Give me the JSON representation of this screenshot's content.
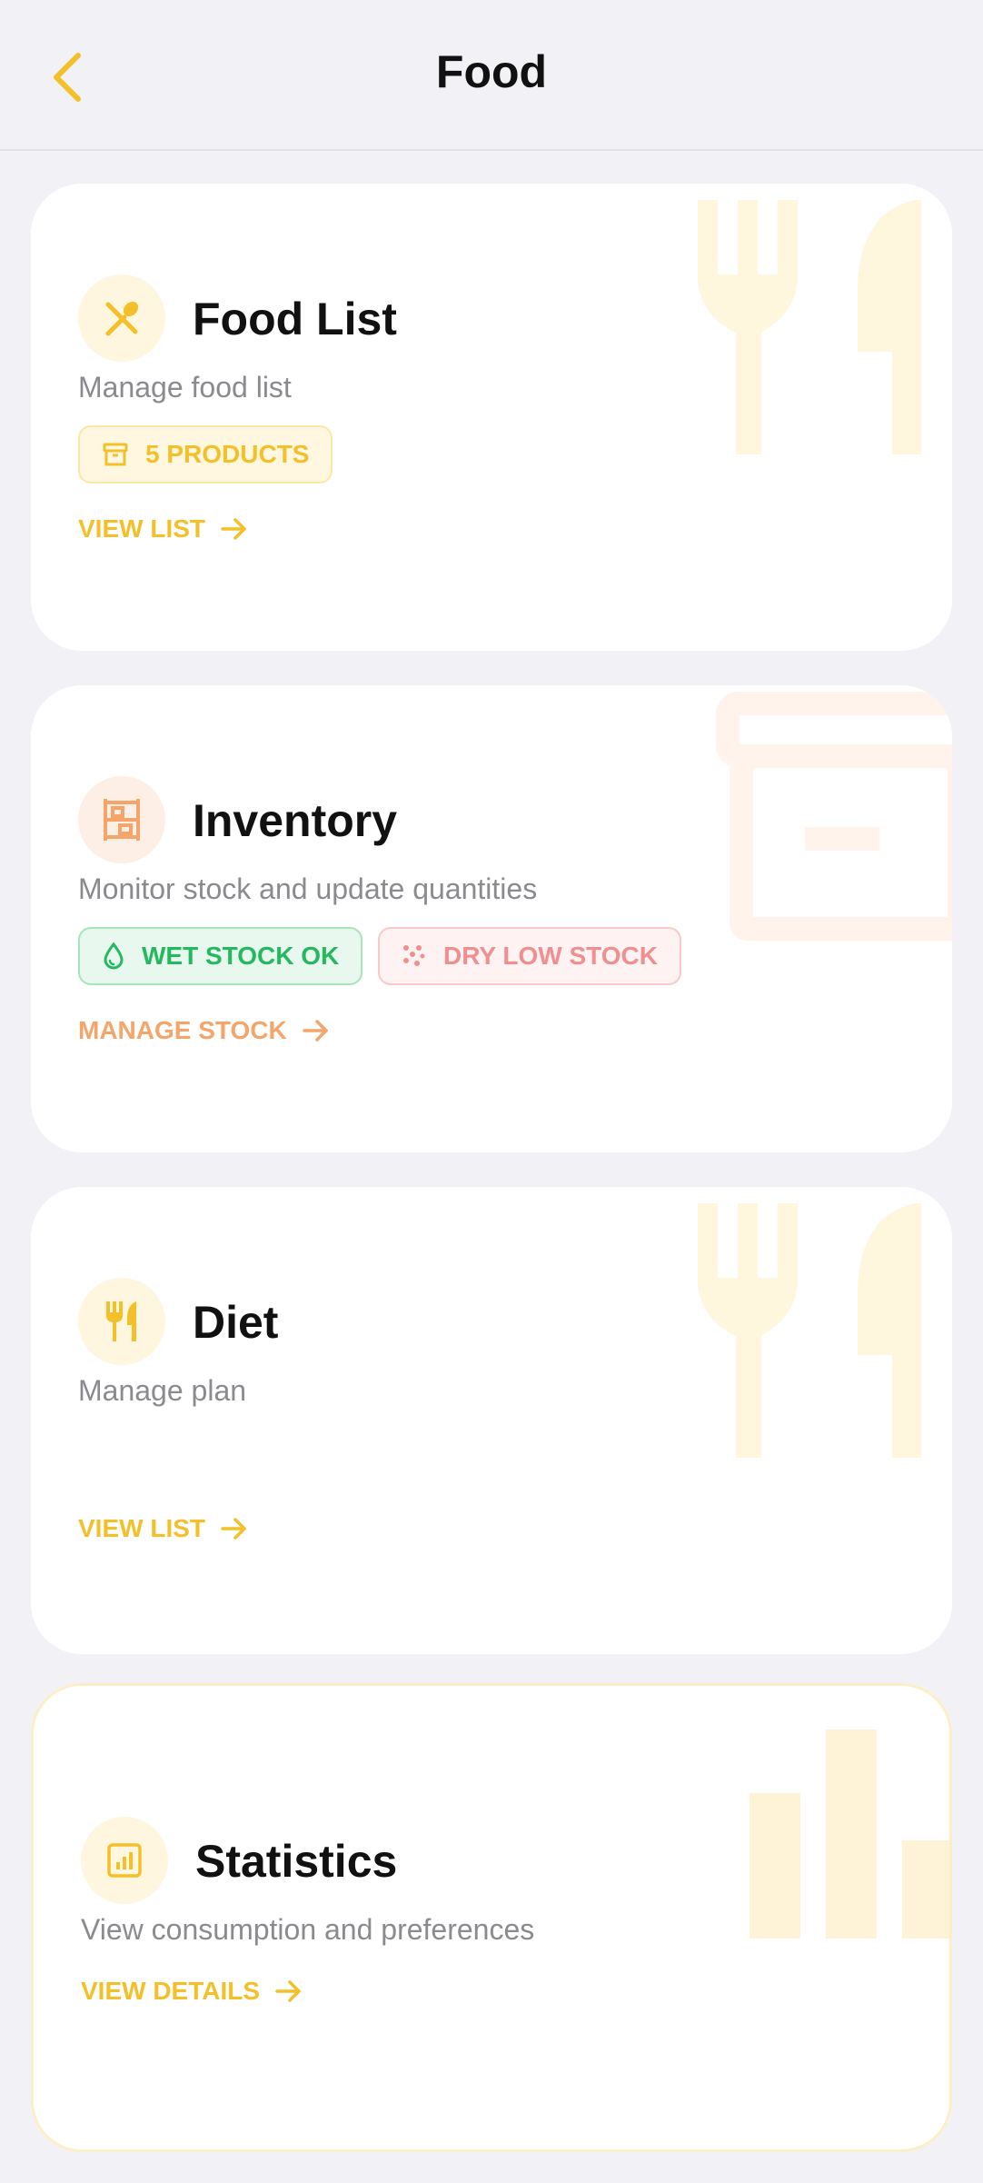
{
  "header": {
    "title": "Food",
    "back_icon": "chevron-left-icon"
  },
  "colors": {
    "accent_yellow": "#f4c02a",
    "accent_orange": "#f6a56a",
    "success_green": "#25b85f",
    "danger_red": "#ef8f8f"
  },
  "cards": [
    {
      "title": "Food List",
      "subtitle": "Manage food list",
      "icon": "fork-spoon-icon",
      "chips": [
        {
          "label": "5 PRODUCTS",
          "icon": "box-icon"
        }
      ],
      "action": "VIEW LIST"
    },
    {
      "title": "Inventory",
      "subtitle": "Monitor stock and update quantities",
      "icon": "shelves-icon",
      "chips": [
        {
          "label": "WET STOCK OK",
          "icon": "drop-icon"
        },
        {
          "label": "DRY LOW STOCK",
          "icon": "grain-icon"
        }
      ],
      "action": "MANAGE STOCK"
    },
    {
      "title": "Diet",
      "subtitle": "Manage plan",
      "icon": "fork-knife-icon",
      "action": "VIEW LIST"
    },
    {
      "title": "Statistics",
      "subtitle": "View consumption and preferences",
      "icon": "bar-chart-icon",
      "action": "VIEW DETAILS"
    }
  ]
}
